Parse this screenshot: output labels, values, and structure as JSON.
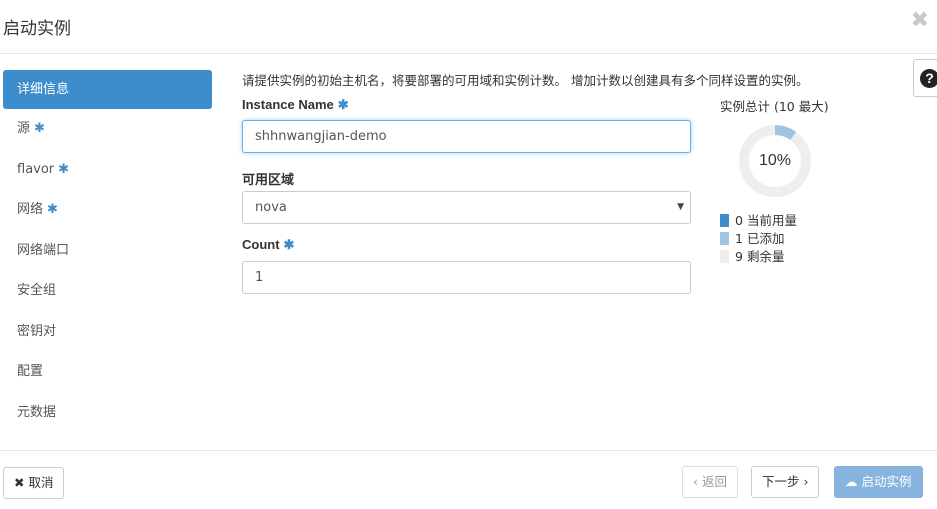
{
  "dialog": {
    "title": "启动实例",
    "close_glyph": "✖"
  },
  "help": {
    "glyph": "?"
  },
  "sidebar": {
    "items": [
      {
        "label": "详细信息",
        "required": false,
        "active": true
      },
      {
        "label": "源",
        "required": true,
        "active": false
      },
      {
        "label": "flavor",
        "required": true,
        "active": false
      },
      {
        "label": "网络",
        "required": true,
        "active": false
      },
      {
        "label": "网络端口",
        "required": false,
        "active": false
      },
      {
        "label": "安全组",
        "required": false,
        "active": false
      },
      {
        "label": "密钥对",
        "required": false,
        "active": false
      },
      {
        "label": "配置",
        "required": false,
        "active": false
      },
      {
        "label": "元数据",
        "required": false,
        "active": false
      }
    ],
    "required_glyph": "✱"
  },
  "form": {
    "intro": "请提供实例的初始主机名，将要部署的可用域和实例计数。 增加计数以创建具有多个同样设置的实例。",
    "instance_name_label": "Instance Name",
    "instance_name_value": "shhnwangjian-demo",
    "zone_label": "可用区域",
    "zone_value": "nova",
    "count_label": "Count",
    "count_value": "1"
  },
  "summary": {
    "title": "实例总计 (10 最大)",
    "percent_label": "10%",
    "used": 0,
    "added": 1,
    "remaining": 9,
    "max": 10,
    "legend": [
      {
        "value": "0",
        "label": "当前用量",
        "color": "#3d8ccc"
      },
      {
        "value": "1",
        "label": "已添加",
        "color": "#a1c4e3"
      },
      {
        "value": "9",
        "label": "剩余量",
        "color": "#eeeeee"
      }
    ]
  },
  "footer": {
    "cancel_label": "取消",
    "back_label": "‹ 返回",
    "next_label": "下一步 ›",
    "launch_label": "启动实例"
  },
  "colors": {
    "accent": "#3d8ccc",
    "primary_disabled": "#87b4de",
    "donut_track": "#eeeeee",
    "donut_added": "#a1c4e3"
  }
}
